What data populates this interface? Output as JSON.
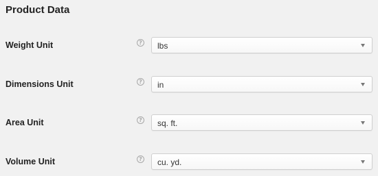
{
  "section": {
    "title": "Product Data"
  },
  "rows": [
    {
      "label": "Weight Unit",
      "value": "lbs"
    },
    {
      "label": "Dimensions Unit",
      "value": "in"
    },
    {
      "label": "Area Unit",
      "value": "sq. ft."
    },
    {
      "label": "Volume Unit",
      "value": "cu. yd."
    }
  ],
  "help_icon_glyph": "?",
  "icons": {
    "help": "help-circle-icon",
    "dropdown": "chevron-down-icon"
  },
  "colors": {
    "background": "#f1f1f1",
    "select_border": "#cfcfcf",
    "help_icon": "#a8a8a8"
  }
}
